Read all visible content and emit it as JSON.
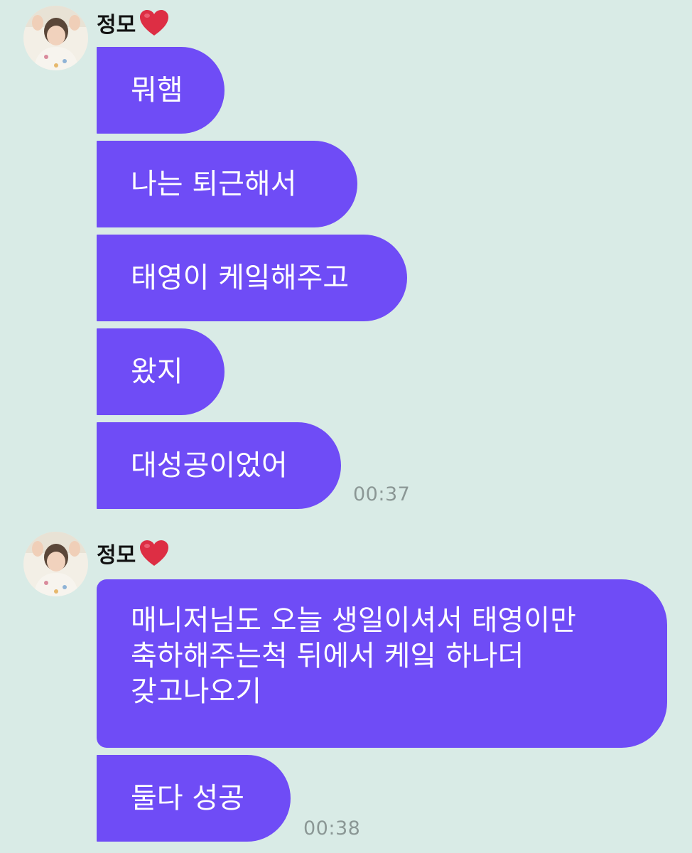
{
  "chat": {
    "groups": [
      {
        "sender": "정모",
        "messages": [
          "뭐햄",
          "나는 퇴근해서",
          "태영이 케잌해주고",
          "왔지",
          "대성공이었어"
        ],
        "time": "00:37"
      },
      {
        "sender": "정모",
        "messages": [
          [
            "매니저님도 오늘 생일이셔서 태영이만",
            "축하해주는척 뒤에서 케잌 하나더",
            "갖고나오기"
          ],
          "둘다 성공"
        ],
        "time": "00:38"
      }
    ]
  },
  "colors": {
    "background": "#d9ebe6",
    "bubble": "#6f4cf6",
    "bubble_text": "#ffffff",
    "time_text": "#8b9795"
  },
  "icons": {
    "sender_badge": "red-heart-icon"
  }
}
